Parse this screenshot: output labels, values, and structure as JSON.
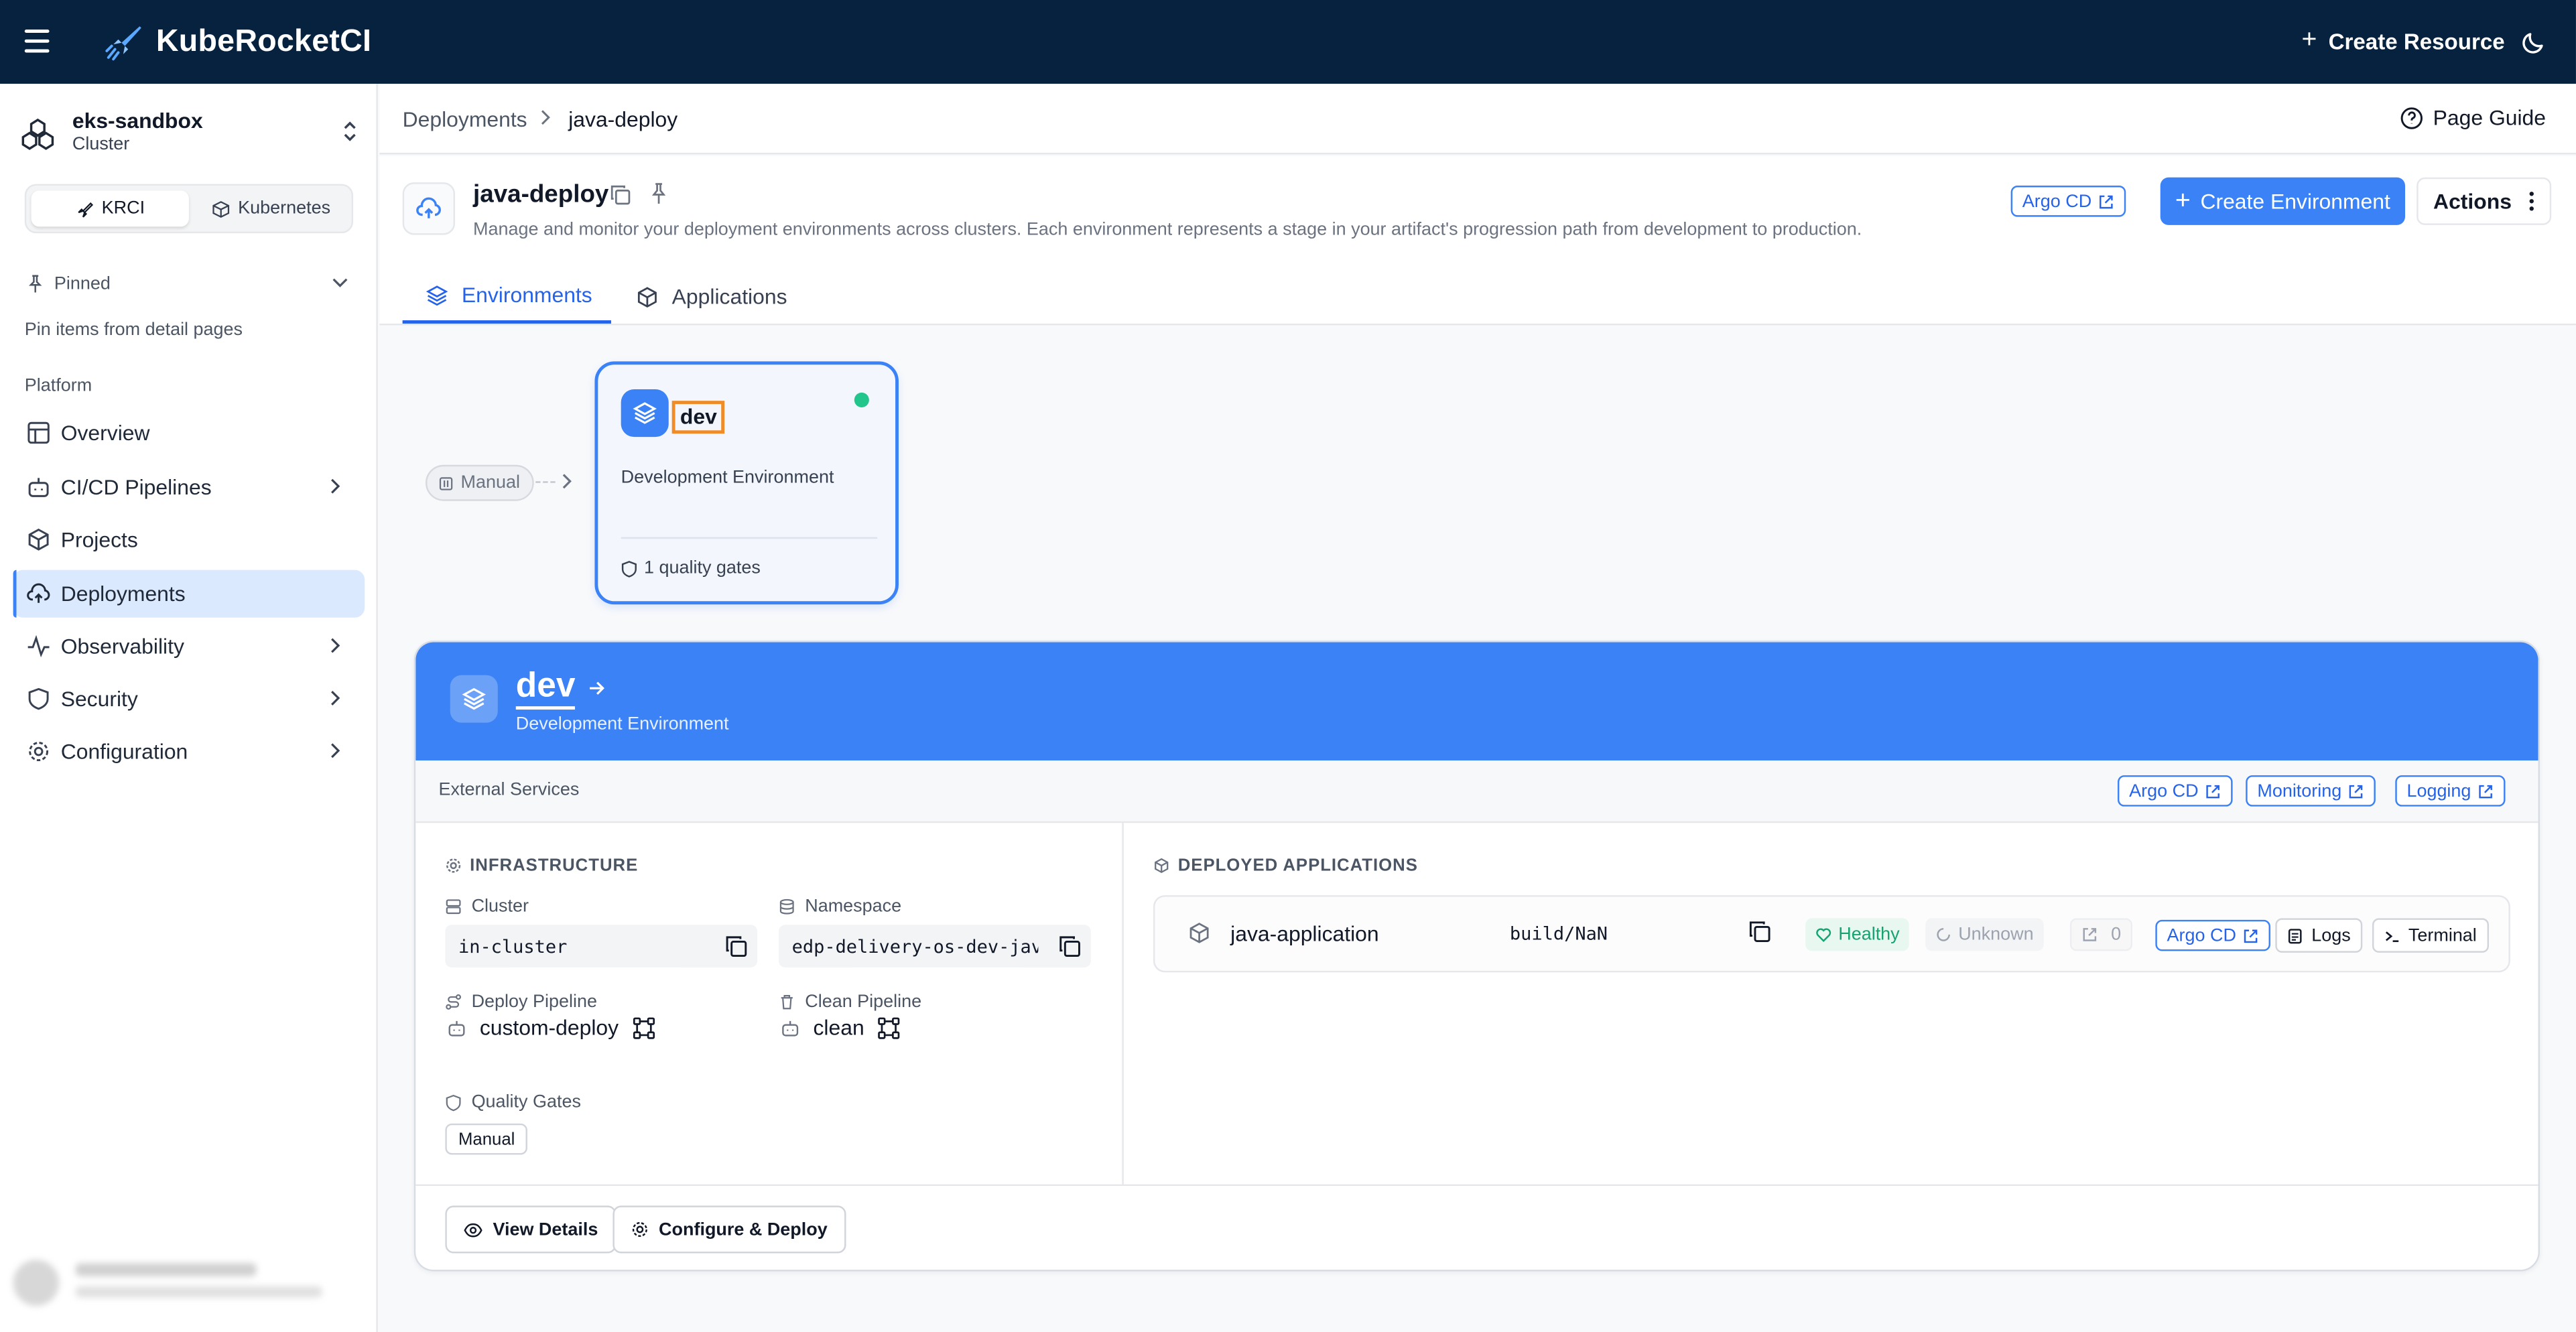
{
  "app": {
    "brand": "KubeRocketCI",
    "create_resource": "Create Resource"
  },
  "sidebar": {
    "cluster_name": "eks-sandbox",
    "cluster_type": "Cluster",
    "mode_tabs": [
      "KRCI",
      "Kubernetes"
    ],
    "pinned_label": "Pinned",
    "pinned_hint": "Pin items from detail pages",
    "section_label": "Platform",
    "items": [
      {
        "label": "Overview",
        "icon": "layout-icon"
      },
      {
        "label": "CI/CD Pipelines",
        "icon": "bot-icon"
      },
      {
        "label": "Projects",
        "icon": "box-icon"
      },
      {
        "label": "Deployments",
        "icon": "cloud-upload-icon"
      },
      {
        "label": "Observability",
        "icon": "activity-icon"
      },
      {
        "label": "Security",
        "icon": "shield-icon"
      },
      {
        "label": "Configuration",
        "icon": "gear-icon"
      }
    ]
  },
  "breadcrumb": {
    "parent": "Deployments",
    "current": "java-deploy",
    "page_guide": "Page Guide"
  },
  "header": {
    "title": "java-deploy",
    "description": "Manage and monitor your deployment environments across clusters. Each environment represents a stage in your artifact's progression path from development to production.",
    "argo_cd": "Argo CD",
    "create_environment": "Create Environment",
    "actions": "Actions",
    "tabs": [
      "Environments",
      "Applications"
    ]
  },
  "flow": {
    "trigger": "Manual",
    "env_card": {
      "name": "dev",
      "description": "Development Environment",
      "quality_gates": "1 quality gates",
      "status_color": "#22c58b"
    }
  },
  "detail": {
    "name": "dev",
    "subtitle": "Development Environment",
    "external_services_label": "External Services",
    "external_links": [
      "Argo CD",
      "Monitoring",
      "Logging"
    ],
    "infrastructure_label": "INFRASTRUCTURE",
    "cluster_label": "Cluster",
    "cluster_value": "in-cluster",
    "namespace_label": "Namespace",
    "namespace_value": "edp-delivery-os-dev-java-deploy",
    "deploy_pipeline_label": "Deploy Pipeline",
    "deploy_pipeline_value": "custom-deploy",
    "clean_pipeline_label": "Clean Pipeline",
    "clean_pipeline_value": "clean",
    "quality_gates_label": "Quality Gates",
    "quality_gate_tag": "Manual",
    "deployed_apps_label": "DEPLOYED APPLICATIONS",
    "apps": [
      {
        "name": "java-application",
        "build": "build/NaN",
        "health": "Healthy",
        "sync": "Unknown",
        "count": "0",
        "argo": "Argo CD",
        "logs": "Logs",
        "terminal": "Terminal"
      }
    ],
    "view_details": "View Details",
    "configure_deploy": "Configure & Deploy"
  },
  "colors": {
    "topbar": "#06223f",
    "accent": "#3b82f6",
    "healthy": "#22c58b",
    "highlight": "#f08c28"
  }
}
